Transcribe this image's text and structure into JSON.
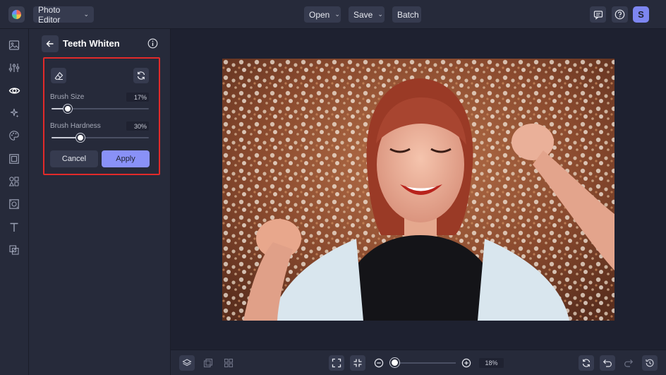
{
  "topbar": {
    "editor_label": "Photo Editor",
    "open_label": "Open",
    "save_label": "Save",
    "batch_label": "Batch",
    "avatar_initial": "S"
  },
  "panel": {
    "title": "Teeth Whiten",
    "brush_size_label": "Brush Size",
    "brush_size_value": "17%",
    "brush_size_fraction": 0.17,
    "brush_hardness_label": "Brush Hardness",
    "brush_hardness_value": "30%",
    "brush_hardness_fraction": 0.3,
    "cancel_label": "Cancel",
    "apply_label": "Apply"
  },
  "bottombar": {
    "zoom_value": "18%"
  },
  "colors": {
    "accent": "#8991f7",
    "highlight_border": "#e12a2a",
    "background": "#1e2130",
    "panel": "#262a3a"
  }
}
